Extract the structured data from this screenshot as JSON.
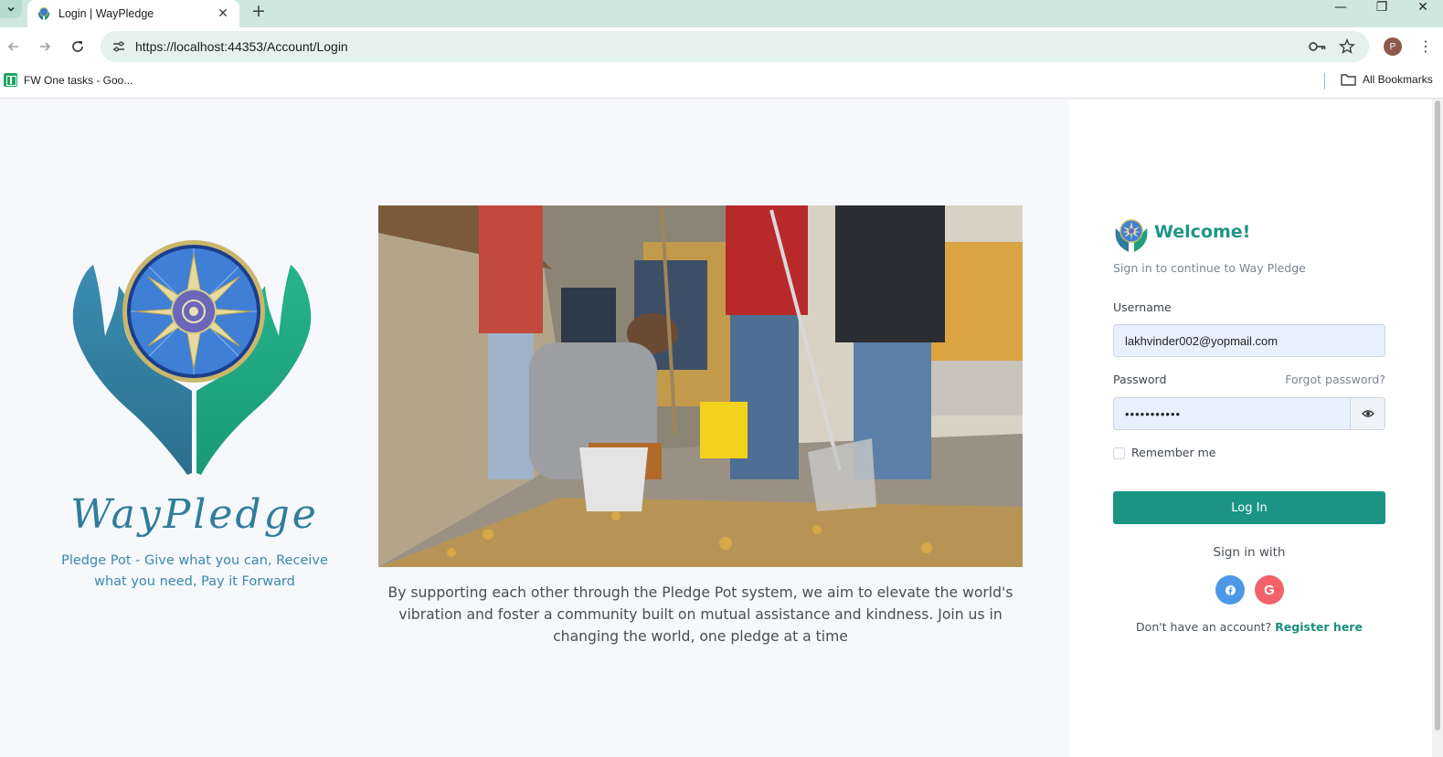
{
  "browser": {
    "tab_title": "Login | WayPledge",
    "tab_close": "✕",
    "new_tab": "+",
    "url": "https://localhost:44353/Account/Login",
    "profile_initial": "P",
    "bookmark": "FW One tasks - Goo...",
    "all_bookmarks": "All Bookmarks",
    "window_controls": {
      "minimize": "—",
      "restore": "❐",
      "close": "✕"
    }
  },
  "hero": {
    "brand_name": "WayPledge",
    "tagline": "Pledge Pot - Give what you can, Receive what you need, Pay it Forward",
    "mission": "By supporting each other through the Pledge Pot system, we aim to elevate the world's vibration and foster a community built on mutual assistance and kindness. Join us in changing the world, one pledge at a time"
  },
  "login": {
    "welcome": "Welcome!",
    "subtitle": "Sign in to continue to Way Pledge",
    "username_label": "Username",
    "username_value": "lakhvinder002@yopmail.com",
    "password_label": "Password",
    "password_value": "•••••••••••",
    "forgot": "Forgot password?",
    "remember": "Remember me",
    "login_button": "Log In",
    "signin_with": "Sign in with",
    "google_letter": "G",
    "no_account": "Don't have an account?",
    "register": "Register here"
  },
  "colors": {
    "accent": "#1a9485",
    "brand_blue": "#2f7d9b",
    "facebook": "#4c98e6",
    "google": "#f2626b"
  },
  "icons": [
    "back-arrow-icon",
    "forward-arrow-icon",
    "reload-icon",
    "site-info-icon",
    "password-key-icon",
    "star-icon",
    "kebab-menu-icon",
    "sheets-icon",
    "folder-icon",
    "eye-icon",
    "facebook-icon",
    "google-icon"
  ]
}
